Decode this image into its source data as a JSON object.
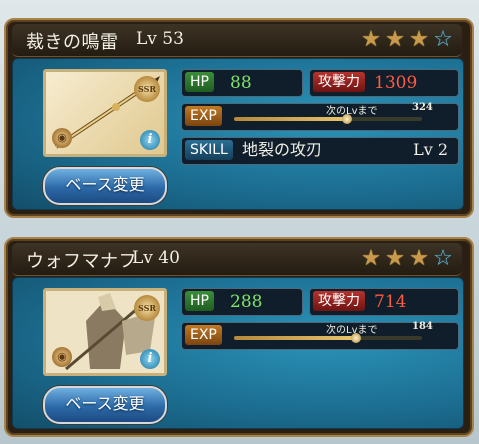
{
  "cards": [
    {
      "name": "裁きの鳴雷",
      "level": "Lv 53",
      "stars_filled": 3,
      "stars_total": 4,
      "rarity_badge": "SSR",
      "element_icon": "earth-icon",
      "info_label": "i",
      "thumbnail_icon": "weapon-spear-icon",
      "hp_label": "HP",
      "hp_value": "88",
      "atk_label": "攻撃力",
      "atk_value": "1309",
      "exp_label": "EXP",
      "exp_next_label": "次のLvまで",
      "exp_next_value": "324",
      "exp_progress": 0.6,
      "skill_label": "SKILL",
      "skill_name": "地裂の攻刃",
      "skill_level": "Lv 2",
      "base_change_label": "ベース変更"
    },
    {
      "name": "ウォフマナフ",
      "level": "Lv 40",
      "stars_filled": 3,
      "stars_total": 4,
      "rarity_badge": "SSR",
      "element_icon": "earth-icon",
      "info_label": "i",
      "thumbnail_icon": "summon-character-icon",
      "hp_label": "HP",
      "hp_value": "288",
      "atk_label": "攻撃力",
      "atk_value": "714",
      "exp_label": "EXP",
      "exp_next_label": "次のLvまで",
      "exp_next_value": "184",
      "exp_progress": 0.65,
      "base_change_label": "ベース変更"
    }
  ],
  "colors": {
    "star_filled": "#c89a4a",
    "star_empty": "#6fc0db",
    "hp_value": "#7fe46a",
    "atk_value": "#ff5a42",
    "panel": "#1c6f93"
  }
}
